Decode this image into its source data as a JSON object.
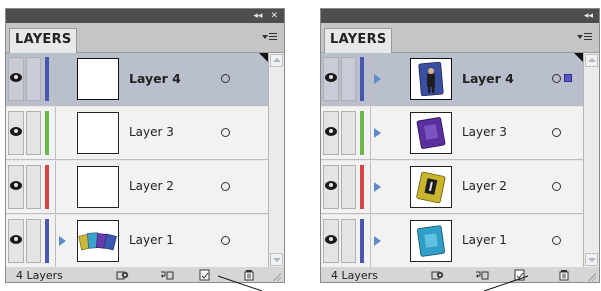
{
  "panels": [
    {
      "title_bar": {
        "collapse_icon": "double-chevron-left-icon",
        "collapse_glyph": "◂◂",
        "close_icon": "close-icon",
        "close_glyph": "✕"
      },
      "tab_label": "LAYERS",
      "menu_icon": "panel-menu-icon",
      "layers": [
        {
          "name": "Layer 4",
          "visible": true,
          "color": "#4a55b0",
          "selected": true,
          "has_children": false,
          "thumbnail": "blank"
        },
        {
          "name": "Layer 3",
          "visible": true,
          "color": "#6ab84a",
          "selected": false,
          "has_children": false,
          "thumbnail": "blank"
        },
        {
          "name": "Layer 2",
          "visible": true,
          "color": "#d64545",
          "selected": false,
          "has_children": false,
          "thumbnail": "blank"
        },
        {
          "name": "Layer 1",
          "visible": true,
          "color": "#4a55b0",
          "selected": false,
          "has_children": true,
          "thumbnail": "cards-spread"
        }
      ],
      "footer": {
        "count_label": "4 Layers",
        "icons": [
          "locate-object-icon",
          "make-sublayer-icon",
          "new-layer-icon",
          "trash-icon"
        ]
      }
    },
    {
      "title_bar": {
        "collapse_icon": "double-chevron-left-icon",
        "collapse_glyph": "◂◂",
        "close_icon": "",
        "close_glyph": ""
      },
      "tab_label": "LAYERS",
      "menu_icon": "panel-menu-icon",
      "layers": [
        {
          "name": "Layer 4",
          "visible": true,
          "color": "#4a55b0",
          "selected": true,
          "has_children": true,
          "thumbnail": "card-person"
        },
        {
          "name": "Layer 3",
          "visible": true,
          "color": "#6ab84a",
          "selected": false,
          "has_children": true,
          "thumbnail": "card-15"
        },
        {
          "name": "Layer 2",
          "visible": true,
          "color": "#d64545",
          "selected": false,
          "has_children": true,
          "thumbnail": "card-1"
        },
        {
          "name": "Layer 1",
          "visible": true,
          "color": "#4a55b0",
          "selected": false,
          "has_children": true,
          "thumbnail": "card-7"
        }
      ],
      "footer": {
        "count_label": "4 Layers",
        "icons": [
          "locate-object-icon",
          "make-sublayer-icon",
          "new-layer-icon",
          "trash-icon"
        ]
      }
    }
  ],
  "colors": {
    "panel_bg": "#d6d6d6",
    "title_bar": "#4d4d4d",
    "selected_row": "#b9bfcc",
    "row_bg": "#f2f2f2",
    "expand_triangle": "#5d8cc8",
    "selection_square": "#5a57c8"
  }
}
